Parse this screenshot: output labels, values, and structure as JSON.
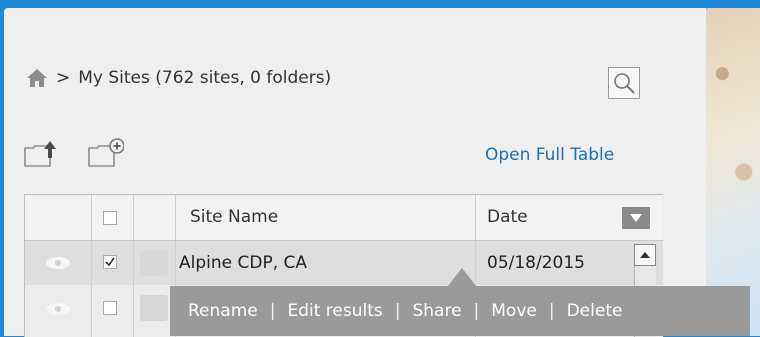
{
  "breadcrumb": {
    "separator": ">",
    "text": "My Sites (762 sites, 0 folders)"
  },
  "links": {
    "open_full_table": "Open Full Table"
  },
  "table": {
    "headers": {
      "site_name": "Site Name",
      "date": "Date"
    },
    "rows": [
      {
        "site_name": "Alpine CDP, CA",
        "date": "05/18/2015",
        "checked": true
      },
      {
        "site_name": "",
        "date": "",
        "checked": false
      }
    ]
  },
  "context_menu": {
    "items": [
      "Rename",
      "Edit results",
      "Share",
      "Move",
      "Delete"
    ],
    "separator": "|"
  },
  "icons": {
    "home": "home-icon",
    "search": "search-icon",
    "upload_folder": "upload-folder-icon",
    "new_folder": "new-folder-icon",
    "visibility": "eye-icon",
    "sort": "sort-down-icon",
    "scroll_up": "scroll-up-icon"
  },
  "colors": {
    "background_blue": "#1f8ad8",
    "panel": "#efefef",
    "link": "#1b6fb3",
    "menu": "#9a9a9a"
  }
}
